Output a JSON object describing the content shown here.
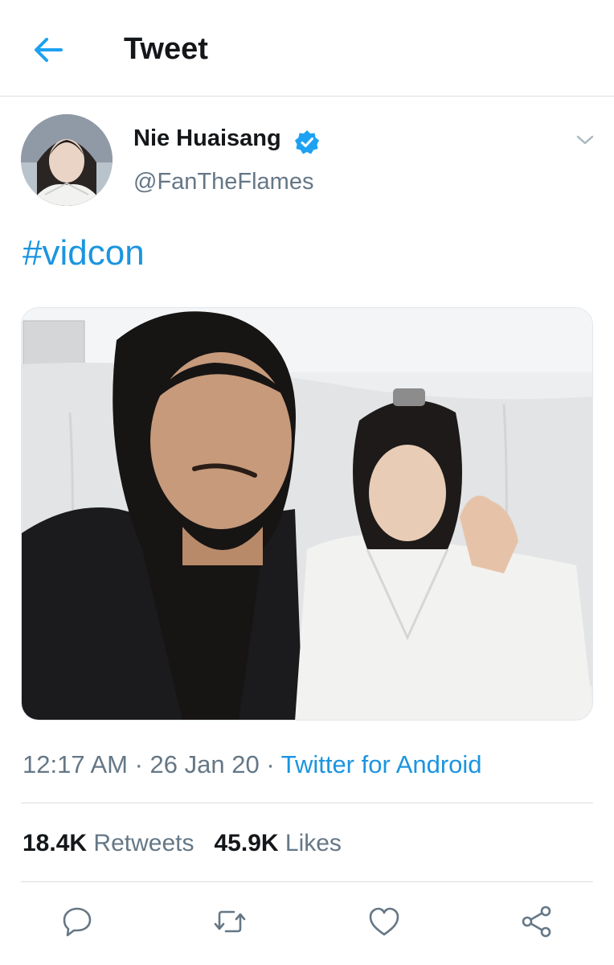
{
  "header": {
    "title": "Tweet",
    "back_icon": "arrow-left-icon"
  },
  "tweet": {
    "author": {
      "display_name": "Nie Huaisang",
      "handle": "@FanTheFlames",
      "verified_icon": "verified-badge-icon"
    },
    "text": "#vidcon",
    "meta": {
      "time": "12:17 AM",
      "separator": " · ",
      "date": "26 Jan 20",
      "source": "Twitter for Android"
    },
    "stats": {
      "retweets_count": "18.4K",
      "retweets_label": "Retweets",
      "likes_count": "45.9K",
      "likes_label": "Likes"
    }
  },
  "actions": [
    "reply-icon",
    "retweet-icon",
    "like-icon",
    "share-icon"
  ],
  "colors": {
    "accent": "#1da1f2",
    "link": "#1b95e0",
    "secondary_text": "#657786",
    "divider": "#d9dee2"
  }
}
